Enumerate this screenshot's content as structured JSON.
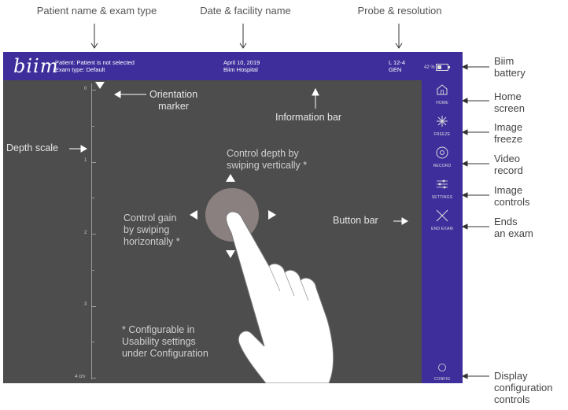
{
  "callouts": {
    "patient_exam": "Patient name & exam type",
    "date_facility": "Date & facility name",
    "probe_resolution": "Probe & resolution",
    "battery": [
      "Biim",
      "battery"
    ],
    "home": [
      "Home",
      "screen"
    ],
    "freeze": [
      "Image",
      "freeze"
    ],
    "record": [
      "Video",
      "record"
    ],
    "controls": [
      "Image",
      "controls"
    ],
    "end": [
      "Ends",
      "an exam"
    ],
    "display": [
      "Display",
      "configuration",
      "controls"
    ],
    "depth_scale": "Depth scale",
    "orientation": [
      "Orientation",
      "marker"
    ],
    "information_bar": "Information bar",
    "button_bar": "Button bar"
  },
  "infobar": {
    "logo": "biim",
    "patient": "Patient: Patient is not selected",
    "exam_type": "Exam type: Default",
    "date": "April 10, 2019",
    "facility": "Biim Hospital",
    "probe": "L 12-4",
    "resolution": "GEN",
    "battery_percent": "42 %",
    "battery_level": 0.42
  },
  "buttons": {
    "home": "HOME",
    "freeze": "FREEZE",
    "record": "RECORD",
    "settings": "SETTINGS",
    "end_exam": "END EXAM",
    "config": "CONFIG"
  },
  "depth_scale": {
    "labels": [
      "0",
      "1",
      "2",
      "3",
      "4 cm"
    ]
  },
  "overlay": {
    "depth_hint": [
      "Control depth by",
      "swiping vertically *"
    ],
    "gain_hint": [
      "Control gain",
      "by swiping",
      "horizontally *"
    ],
    "config_note": [
      "* Configurable in",
      "Usability settings",
      "under Configuration"
    ]
  }
}
